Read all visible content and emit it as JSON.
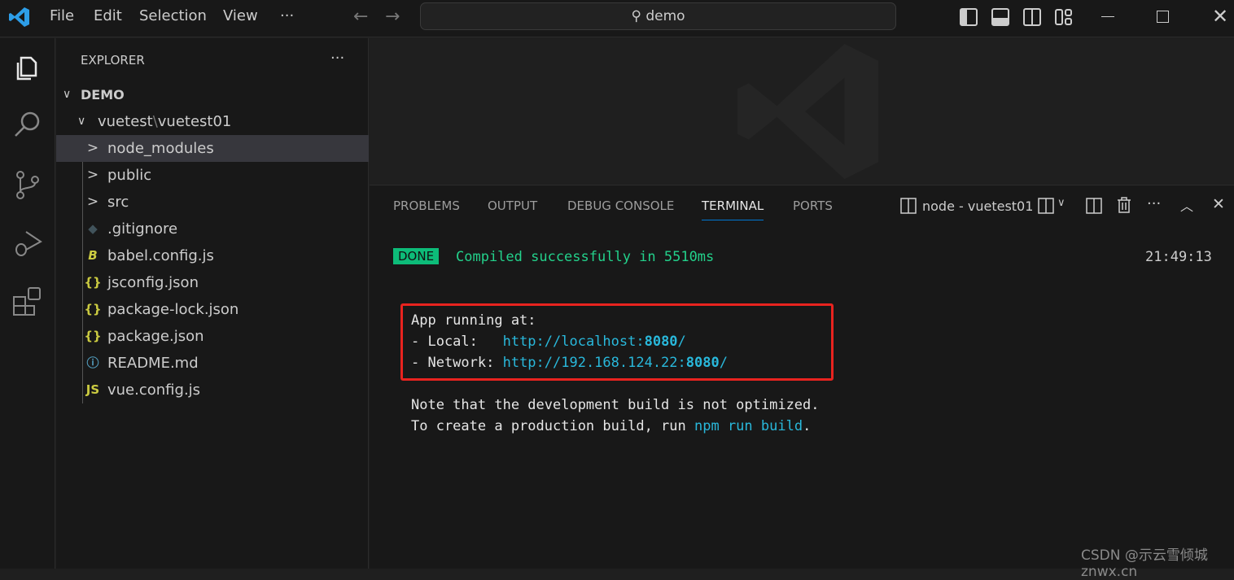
{
  "titlebar": {
    "menu": [
      "File",
      "Edit",
      "Selection",
      "View",
      "···"
    ],
    "search": "demo"
  },
  "explorer": {
    "title": "EXPLORER",
    "more": "···",
    "root": "DEMO",
    "folder": "vuetest",
    "sep": "\\",
    "subfolder": "vuetest01",
    "items": [
      {
        "label": "node_modules",
        "icon": "chevron-right",
        "glyph": ">"
      },
      {
        "label": "public",
        "icon": "chevron-right",
        "glyph": ">"
      },
      {
        "label": "src",
        "icon": "chevron-right",
        "glyph": ">"
      },
      {
        "label": ".gitignore",
        "icon": "git-icon",
        "glyph": "◆",
        "color": "#41535b"
      },
      {
        "label": "babel.config.js",
        "icon": "babel-icon",
        "glyph": "B",
        "color": "#cbcb41"
      },
      {
        "label": "jsconfig.json",
        "icon": "json-icon",
        "glyph": "{}",
        "color": "#cbcb41"
      },
      {
        "label": "package-lock.json",
        "icon": "json-icon",
        "glyph": "{}",
        "color": "#cbcb41"
      },
      {
        "label": "package.json",
        "icon": "json-icon",
        "glyph": "{}",
        "color": "#cbcb41"
      },
      {
        "label": "README.md",
        "icon": "info-icon",
        "glyph": "ⓘ",
        "color": "#519aba"
      },
      {
        "label": "vue.config.js",
        "icon": "js-icon",
        "glyph": "JS",
        "color": "#cbcb41"
      }
    ]
  },
  "panel": {
    "tabs": [
      "PROBLEMS",
      "OUTPUT",
      "DEBUG CONSOLE",
      "TERMINAL",
      "PORTS"
    ],
    "terminal_name": "node - vuetest01"
  },
  "terminal": {
    "done": "DONE",
    "compiled": "Compiled successfully in 5510ms",
    "time": "21:49:13",
    "app_running": "App running at:",
    "local_label": "- Local:   ",
    "local_url": "http://localhost:",
    "local_port": "8080",
    "slash": "/",
    "network_label": "- Network: ",
    "network_url": "http://192.168.124.22:",
    "network_port": "8080",
    "note1": "Note that the development build is not optimized.",
    "note2": "To create a production build, run ",
    "cmd": "npm run build",
    "period": "."
  },
  "watermark": "CSDN @示云雪倾城 znwx.cn",
  "colors": {
    "accent": "#0078d4",
    "done_bg": "#0dbc79",
    "link": "#29b8db",
    "highlight_box": "#e8231f"
  }
}
